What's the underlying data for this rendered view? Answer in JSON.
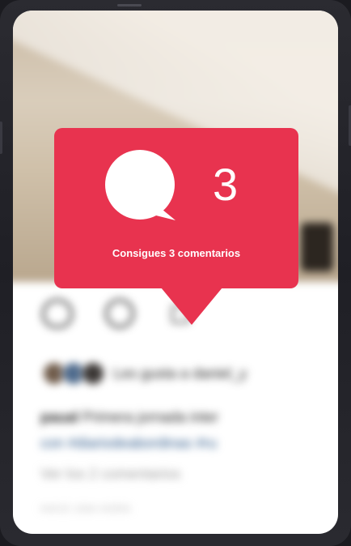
{
  "post": {
    "liked_by_text": "Les gusta a daniel_y",
    "caption_user": "paual",
    "caption_text": " Primera jornada inter",
    "caption_hashtags": "con #diariodeabordinas #ru",
    "view_comments": "Ver los 2 comentarios",
    "timestamp": "HACE UNA HORA"
  },
  "notification": {
    "icon": "comment-bubble-icon",
    "count": "3",
    "message": "Consigues 3 comentarios",
    "color": "#e8334f"
  }
}
